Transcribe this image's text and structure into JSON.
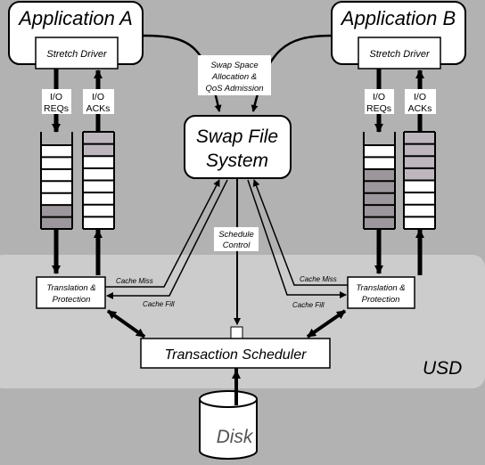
{
  "colors": {
    "background": "#b2b2b2",
    "usd_region": "#cccccc",
    "dark_slot": "#9c979c",
    "light_slot": "#bdb7bd"
  },
  "app_a": {
    "title": "Application A",
    "driver": "Stretch Driver"
  },
  "app_b": {
    "title": "Application B",
    "driver": "Stretch Driver"
  },
  "io_req": {
    "line1": "I/O",
    "line2": "REQs"
  },
  "io_ack": {
    "line1": "I/O",
    "line2": "ACKs"
  },
  "swap_label": {
    "line1": "Swap Space",
    "line2": "Allocation &",
    "line3": "QoS Admission"
  },
  "swap_fs": {
    "line1": "Swap File",
    "line2": "System"
  },
  "schedule_control": {
    "line1": "Schedule",
    "line2": "Control"
  },
  "tp": {
    "line1": "Translation &",
    "line2": "Protection"
  },
  "cache_miss": "Cache Miss",
  "cache_fill": "Cache Fill",
  "scheduler": "Transaction Scheduler",
  "usd": "USD",
  "disk": "Disk",
  "queues": {
    "left_req": {
      "slots": 7,
      "dark_slots": [
        5,
        6
      ]
    },
    "left_ack": {
      "slots": 8,
      "light_slots": [
        0,
        1
      ]
    },
    "right_req": {
      "slots": 7,
      "dark_slots": [
        2,
        3,
        4,
        5,
        6
      ]
    },
    "right_ack": {
      "slots": 8,
      "light_slots": [
        0,
        1,
        2,
        3
      ]
    }
  }
}
